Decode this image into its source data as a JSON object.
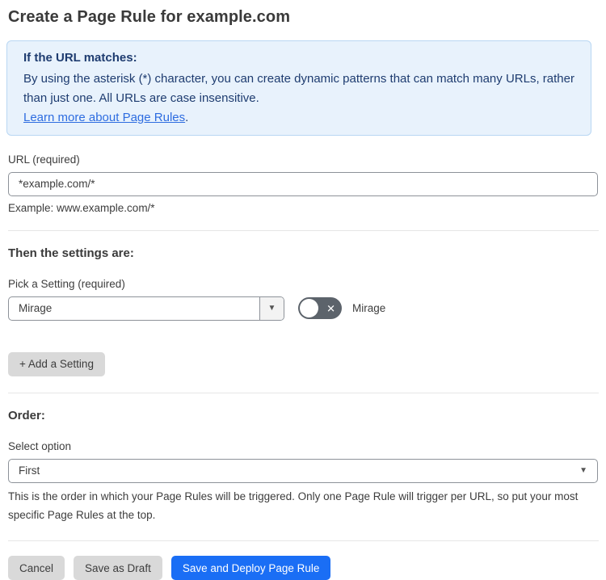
{
  "page": {
    "title": "Create a Page Rule for example.com"
  },
  "info_box": {
    "heading": "If the URL matches:",
    "body": "By using the asterisk (*) character, you can create dynamic patterns that can match many URLs, rather than just one. All URLs are case insensitive.",
    "link_label": "Learn more about Page Rules",
    "link_suffix": "."
  },
  "url_field": {
    "label": "URL (required)",
    "value": "*example.com/*",
    "helper": "Example: www.example.com/*"
  },
  "settings": {
    "heading": "Then the settings are:",
    "picker_label": "Pick a Setting (required)",
    "picker_value": "Mirage",
    "toggle_label": "Mirage",
    "toggle_state": "off",
    "toggle_icon": "✕",
    "add_button_label": "+ Add a Setting"
  },
  "order": {
    "heading": "Order:",
    "select_label": "Select option",
    "select_value": "First",
    "helper": "This is the order in which your Page Rules will be triggered. Only one Page Rule will trigger per URL, so put your most specific Page Rules at the top."
  },
  "footer": {
    "cancel_label": "Cancel",
    "save_draft_label": "Save as Draft",
    "save_deploy_label": "Save and Deploy Page Rule"
  },
  "icons": {
    "dropdown_caret": "▼"
  },
  "colors": {
    "primary_blue": "#1a6ef5",
    "info_background": "#e8f2fc",
    "info_border": "#b9d7f3",
    "info_text": "#1e3c70",
    "link_blue": "#2d6ce0",
    "toggle_off_gray": "#5c636b",
    "button_gray": "#d9d9d9",
    "input_border_gray": "#8d9299",
    "divider_gray": "#e6e6e6"
  }
}
